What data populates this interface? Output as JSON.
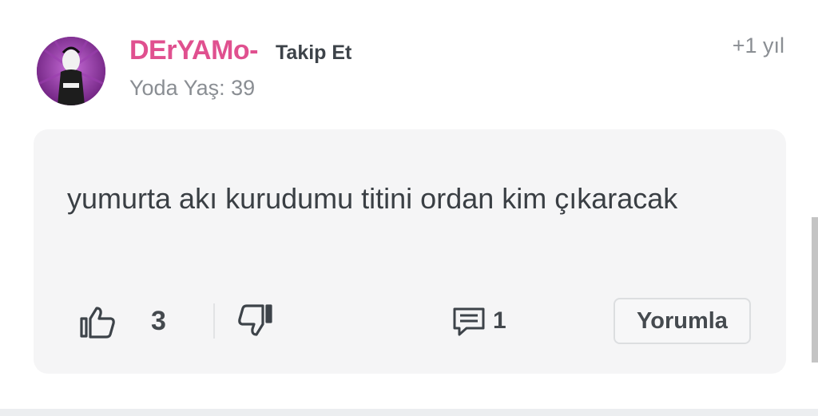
{
  "comment": {
    "username": "DErYAMo-",
    "follow_label": "Takip Et",
    "user_meta": "Yoda Yaş: 39",
    "time": "+1 yıl",
    "text": "yumurta akı kurudumu titini ordan kim çıkaracak",
    "likes": "3",
    "comments": "1",
    "reply_label": "Yorumla"
  },
  "icons": {
    "like": "thumbs-up-icon",
    "dislike": "thumbs-down-icon",
    "comment": "comment-icon"
  },
  "colors": {
    "username": "#e0508f",
    "card_background": "#f5f5f6"
  }
}
